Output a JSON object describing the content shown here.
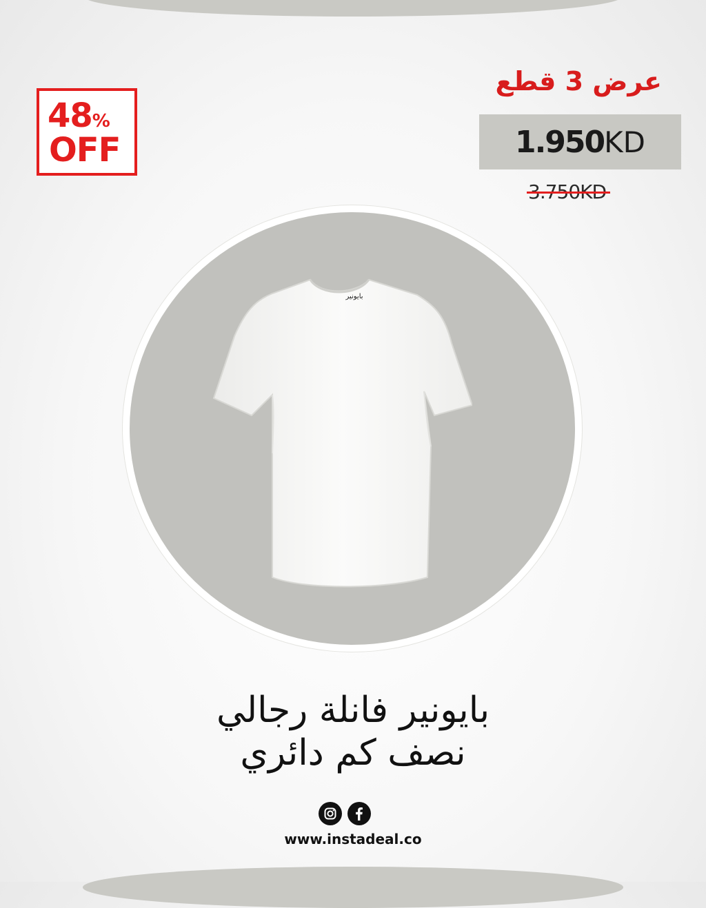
{
  "discount": {
    "percent": "48",
    "percent_sign": "%",
    "off": "OFF"
  },
  "offer": {
    "label": "عرض 3 قطع"
  },
  "price": {
    "current_amount": "1.950",
    "current_currency": "KD",
    "old": "3.750KD"
  },
  "product": {
    "brand_on_shirt": "بايونير",
    "title_line1": "بايونير فانلة رجالي",
    "title_line2": "نصف كم دائري"
  },
  "footer": {
    "website": "www.instadeal.co",
    "icons": [
      "instagram-icon",
      "facebook-icon"
    ]
  },
  "colors": {
    "accent_red": "#e41e1e",
    "price_box": "#c8c8c3",
    "circle_fill": "#c1c1bd"
  }
}
